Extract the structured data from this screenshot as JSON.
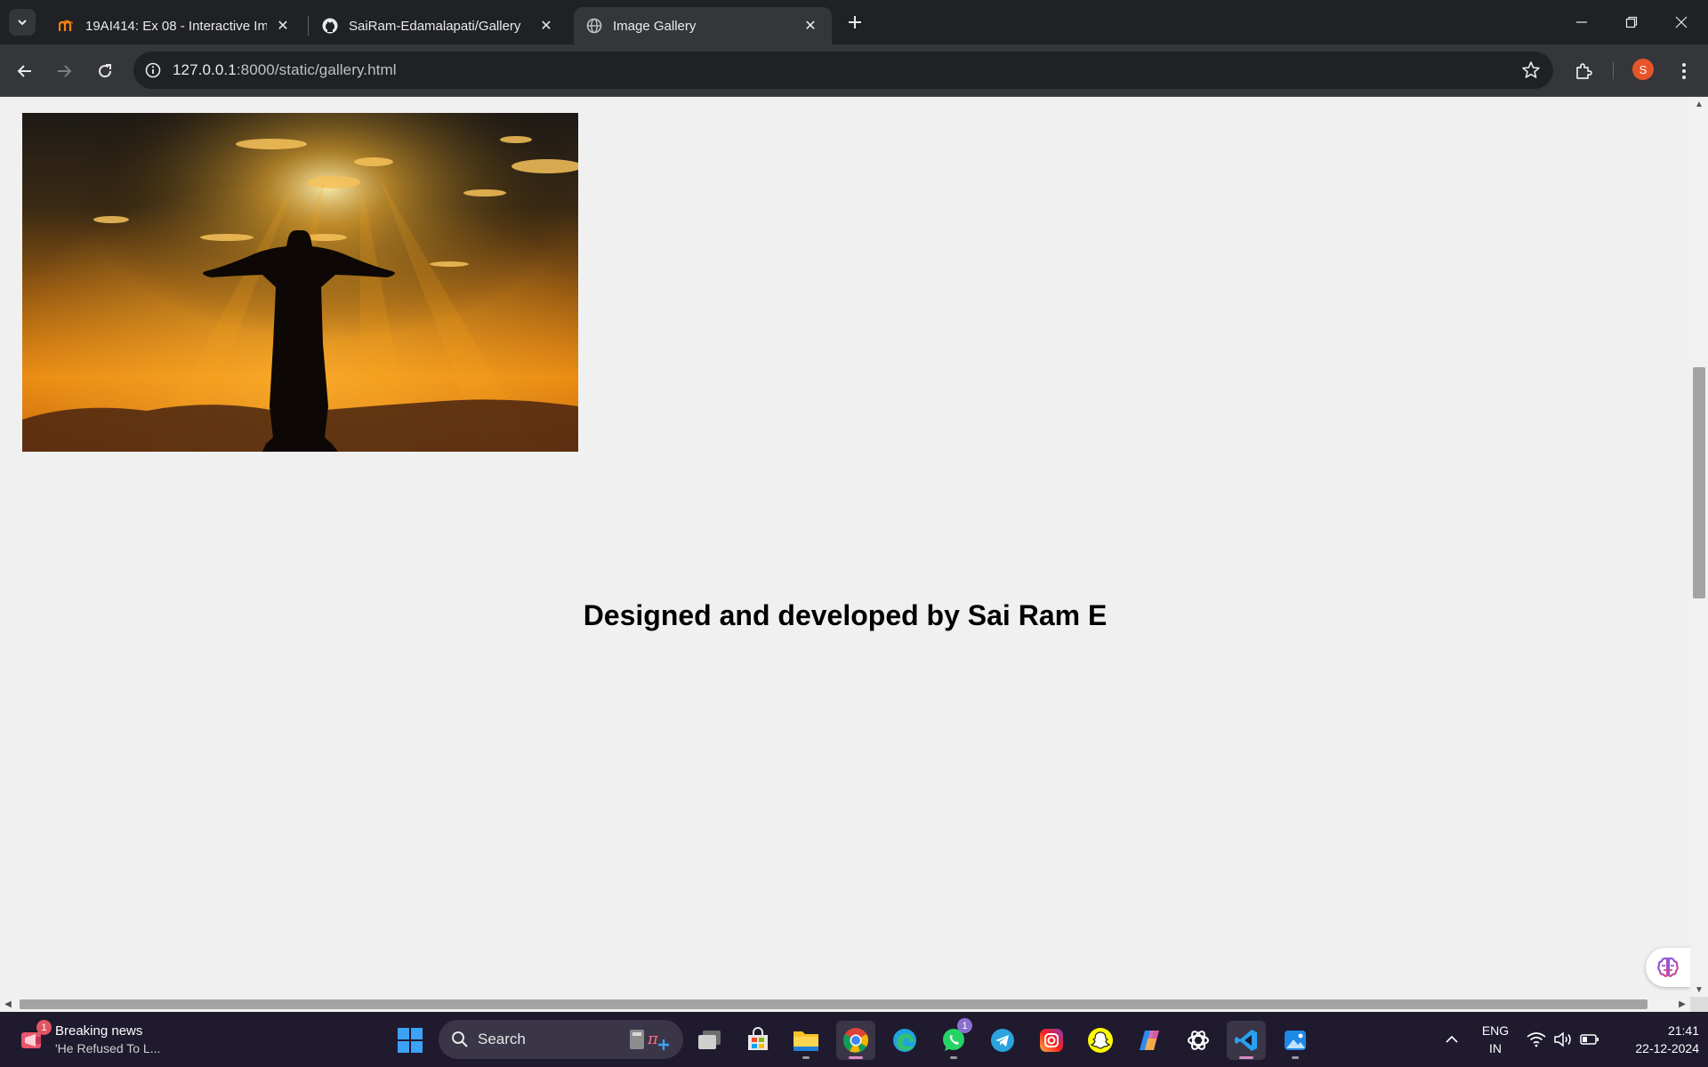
{
  "browser": {
    "tabs": [
      {
        "title": "19AI414: Ex 08 - Interactive Ima",
        "favicon": "moodle-icon",
        "active": false
      },
      {
        "title": "SaiRam-Edamalapati/Gallery",
        "favicon": "github-icon",
        "active": false
      },
      {
        "title": "Image Gallery",
        "favicon": "globe-icon",
        "active": true
      }
    ],
    "address": {
      "host": "127.0.0.1",
      "path": ":8000/static/gallery.html"
    },
    "profile_initial": "S"
  },
  "page": {
    "image": {
      "description_icon": "statue-sunset-image"
    },
    "footer_text": "Designed and developed by Sai Ram E"
  },
  "taskbar": {
    "news": {
      "title": "Breaking news",
      "subtitle": "'He Refused To L...",
      "badge": "1"
    },
    "search_label": "Search",
    "whatsapp_badge": "1",
    "tray": {
      "lang_line1": "ENG",
      "lang_line2": "IN",
      "time": "21:41",
      "date": "22-12-2024"
    }
  }
}
